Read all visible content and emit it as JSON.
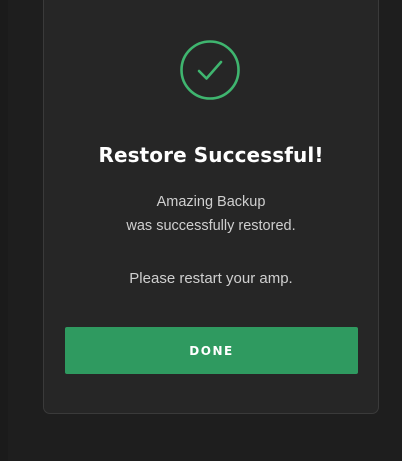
{
  "dialog": {
    "icon": "check-circle-icon",
    "title": "Restore Successful!",
    "message_line1": "Amazing Backup",
    "message_line2": "was successfully restored.",
    "instruction": "Please restart your amp.",
    "done_label": "DONE"
  },
  "colors": {
    "accent": "#2f9a60",
    "icon": "#3fb56f",
    "dialog_bg": "#262626",
    "page_bg": "#1b1b1b"
  }
}
